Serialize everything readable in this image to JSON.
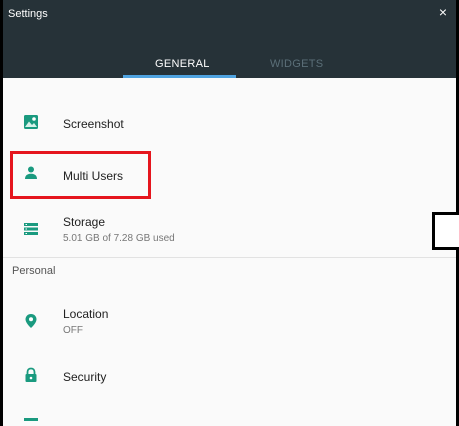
{
  "window": {
    "title": "Settings",
    "close_glyph": "×"
  },
  "tabs": [
    {
      "label": "GENERAL",
      "active": true
    },
    {
      "label": "WIDGETS",
      "active": false
    }
  ],
  "items": {
    "screenshot": {
      "label": "Screenshot",
      "icon": "screenshot-icon"
    },
    "multi_users": {
      "label": "Multi Users",
      "icon": "person-icon"
    },
    "storage": {
      "label": "Storage",
      "summary": "5.01 GB of 7.28 GB used",
      "icon": "storage-icon"
    },
    "location": {
      "label": "Location",
      "summary": "OFF",
      "icon": "location-pin-icon"
    },
    "security": {
      "label": "Security",
      "icon": "lock-icon"
    }
  },
  "sections": {
    "personal": "Personal"
  },
  "colors": {
    "header_bg": "#263238",
    "tab_indicator": "#4fa3e0",
    "icon_accent": "#1a9a7f",
    "highlight": "#e5151d"
  }
}
